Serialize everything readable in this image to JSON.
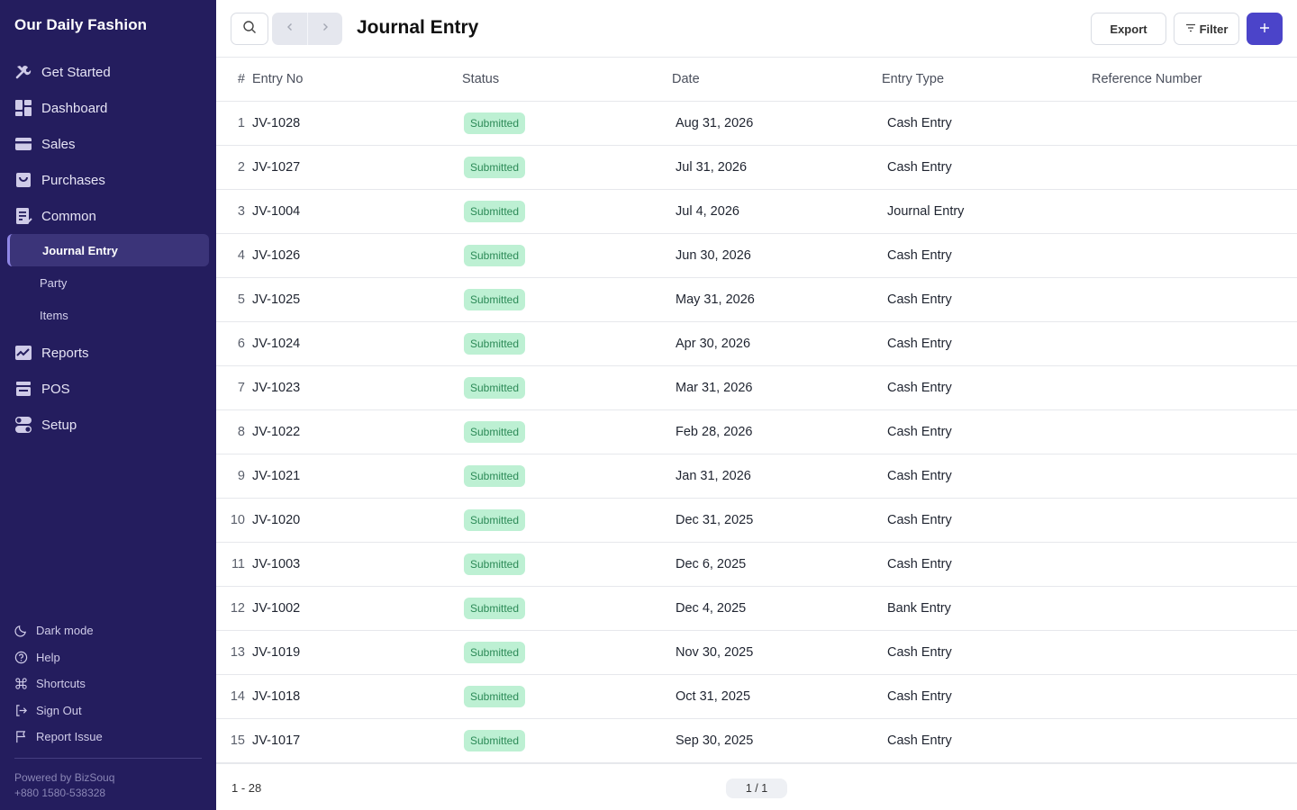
{
  "app": {
    "brand": "Our Daily Fashion"
  },
  "sidebar": {
    "items": [
      {
        "label": "Get Started",
        "icon": "tools-icon"
      },
      {
        "label": "Dashboard",
        "icon": "dashboard-icon"
      },
      {
        "label": "Sales",
        "icon": "sales-card-icon"
      },
      {
        "label": "Purchases",
        "icon": "purchases-box-icon"
      },
      {
        "label": "Common",
        "icon": "common-doc-icon"
      }
    ],
    "sub_items": [
      {
        "label": "Journal Entry",
        "active": true
      },
      {
        "label": "Party",
        "active": false
      },
      {
        "label": "Items",
        "active": false
      }
    ],
    "items_after": [
      {
        "label": "Reports",
        "icon": "reports-chart-icon"
      },
      {
        "label": "POS",
        "icon": "pos-register-icon"
      },
      {
        "label": "Setup",
        "icon": "setup-toggle-icon"
      }
    ],
    "bottom": [
      {
        "label": "Dark mode",
        "icon": "moon-icon"
      },
      {
        "label": "Help",
        "icon": "help-circle-icon"
      },
      {
        "label": "Shortcuts",
        "icon": "command-icon"
      },
      {
        "label": "Sign Out",
        "icon": "sign-out-icon"
      },
      {
        "label": "Report Issue",
        "icon": "flag-icon"
      }
    ],
    "powered_by": "Powered by BizSouq",
    "phone": "+880 1580-538328"
  },
  "header": {
    "title": "Journal Entry",
    "export_label": "Export",
    "filter_label": "Filter",
    "add_label": "+"
  },
  "table": {
    "columns": [
      "#",
      "Entry No",
      "Status",
      "Date",
      "Entry Type",
      "Reference Number"
    ],
    "rows": [
      {
        "n": "1",
        "entry": "JV-1028",
        "status": "Submitted",
        "date": "Aug 31, 2026",
        "type": "Cash Entry",
        "ref": ""
      },
      {
        "n": "2",
        "entry": "JV-1027",
        "status": "Submitted",
        "date": "Jul 31, 2026",
        "type": "Cash Entry",
        "ref": ""
      },
      {
        "n": "3",
        "entry": "JV-1004",
        "status": "Submitted",
        "date": "Jul 4, 2026",
        "type": "Journal Entry",
        "ref": ""
      },
      {
        "n": "4",
        "entry": "JV-1026",
        "status": "Submitted",
        "date": "Jun 30, 2026",
        "type": "Cash Entry",
        "ref": ""
      },
      {
        "n": "5",
        "entry": "JV-1025",
        "status": "Submitted",
        "date": "May 31, 2026",
        "type": "Cash Entry",
        "ref": ""
      },
      {
        "n": "6",
        "entry": "JV-1024",
        "status": "Submitted",
        "date": "Apr 30, 2026",
        "type": "Cash Entry",
        "ref": ""
      },
      {
        "n": "7",
        "entry": "JV-1023",
        "status": "Submitted",
        "date": "Mar 31, 2026",
        "type": "Cash Entry",
        "ref": ""
      },
      {
        "n": "8",
        "entry": "JV-1022",
        "status": "Submitted",
        "date": "Feb 28, 2026",
        "type": "Cash Entry",
        "ref": ""
      },
      {
        "n": "9",
        "entry": "JV-1021",
        "status": "Submitted",
        "date": "Jan 31, 2026",
        "type": "Cash Entry",
        "ref": ""
      },
      {
        "n": "10",
        "entry": "JV-1020",
        "status": "Submitted",
        "date": "Dec 31, 2025",
        "type": "Cash Entry",
        "ref": ""
      },
      {
        "n": "11",
        "entry": "JV-1003",
        "status": "Submitted",
        "date": "Dec 6, 2025",
        "type": "Cash Entry",
        "ref": ""
      },
      {
        "n": "12",
        "entry": "JV-1002",
        "status": "Submitted",
        "date": "Dec 4, 2025",
        "type": "Bank Entry",
        "ref": ""
      },
      {
        "n": "13",
        "entry": "JV-1019",
        "status": "Submitted",
        "date": "Nov 30, 2025",
        "type": "Cash Entry",
        "ref": ""
      },
      {
        "n": "14",
        "entry": "JV-1018",
        "status": "Submitted",
        "date": "Oct 31, 2025",
        "type": "Cash Entry",
        "ref": ""
      },
      {
        "n": "15",
        "entry": "JV-1017",
        "status": "Submitted",
        "date": "Sep 30, 2025",
        "type": "Cash Entry",
        "ref": ""
      }
    ]
  },
  "footer": {
    "range": "1 - 28",
    "page": "1 / 1"
  },
  "colors": {
    "sidebar_bg": "#241d5e",
    "accent": "#4b44c9",
    "badge_bg": "#bdf0d3",
    "badge_text": "#2c8a57"
  }
}
